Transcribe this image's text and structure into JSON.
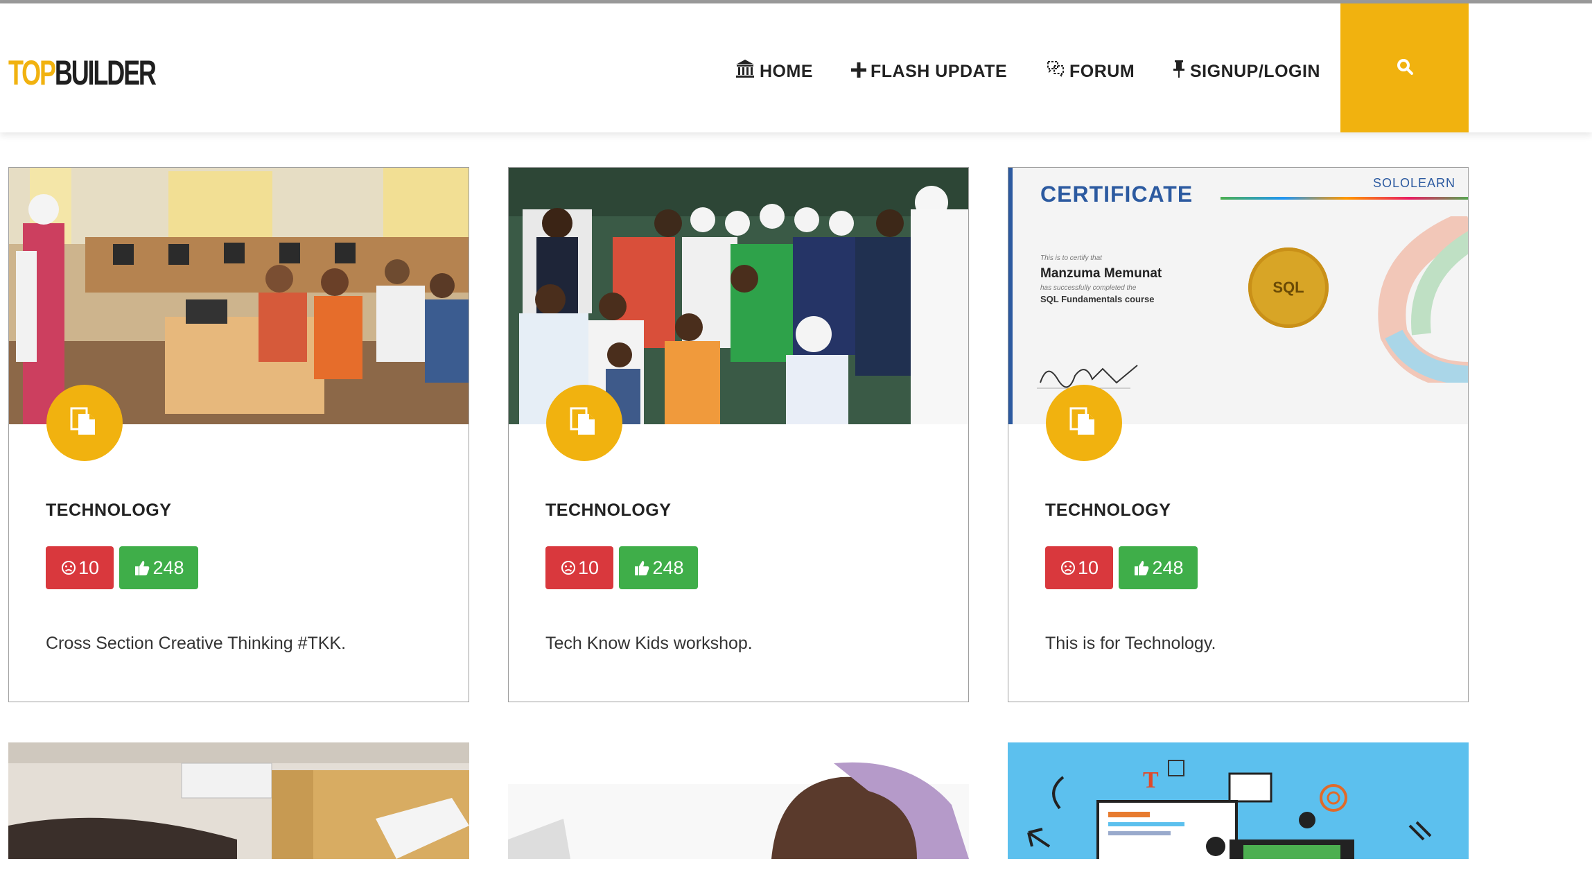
{
  "brand": {
    "top": "TOP",
    "builder": "BUILDER",
    "accent": "#f1b20f"
  },
  "nav": {
    "home": "HOME",
    "flash_update": "FLASH UPDATE",
    "forum": "FORUM",
    "signup_login": "SIGNUP/LOGIN"
  },
  "search": {
    "icon": "search-icon"
  },
  "posts": [
    {
      "category": "TECHNOLOGY",
      "dislikes": "10",
      "likes": "248",
      "description": "Cross Section Creative Thinking #TKK."
    },
    {
      "category": "TECHNOLOGY",
      "dislikes": "10",
      "likes": "248",
      "description": "Tech Know Kids workshop."
    },
    {
      "category": "TECHNOLOGY",
      "dislikes": "10",
      "likes": "248",
      "description": "This is for Technology."
    }
  ],
  "certificate": {
    "title": "CERTIFICATE",
    "brand": "SOLOLEARN",
    "certify_text": "This is to certify that",
    "name": "Manzuma Memunat",
    "completed_text": "has successfully completed the",
    "course": "SQL Fundamentals course",
    "seal_text": "SQL"
  },
  "colors": {
    "dislike": "#d9383d",
    "like": "#3fae49",
    "badge": "#f1b20f"
  }
}
